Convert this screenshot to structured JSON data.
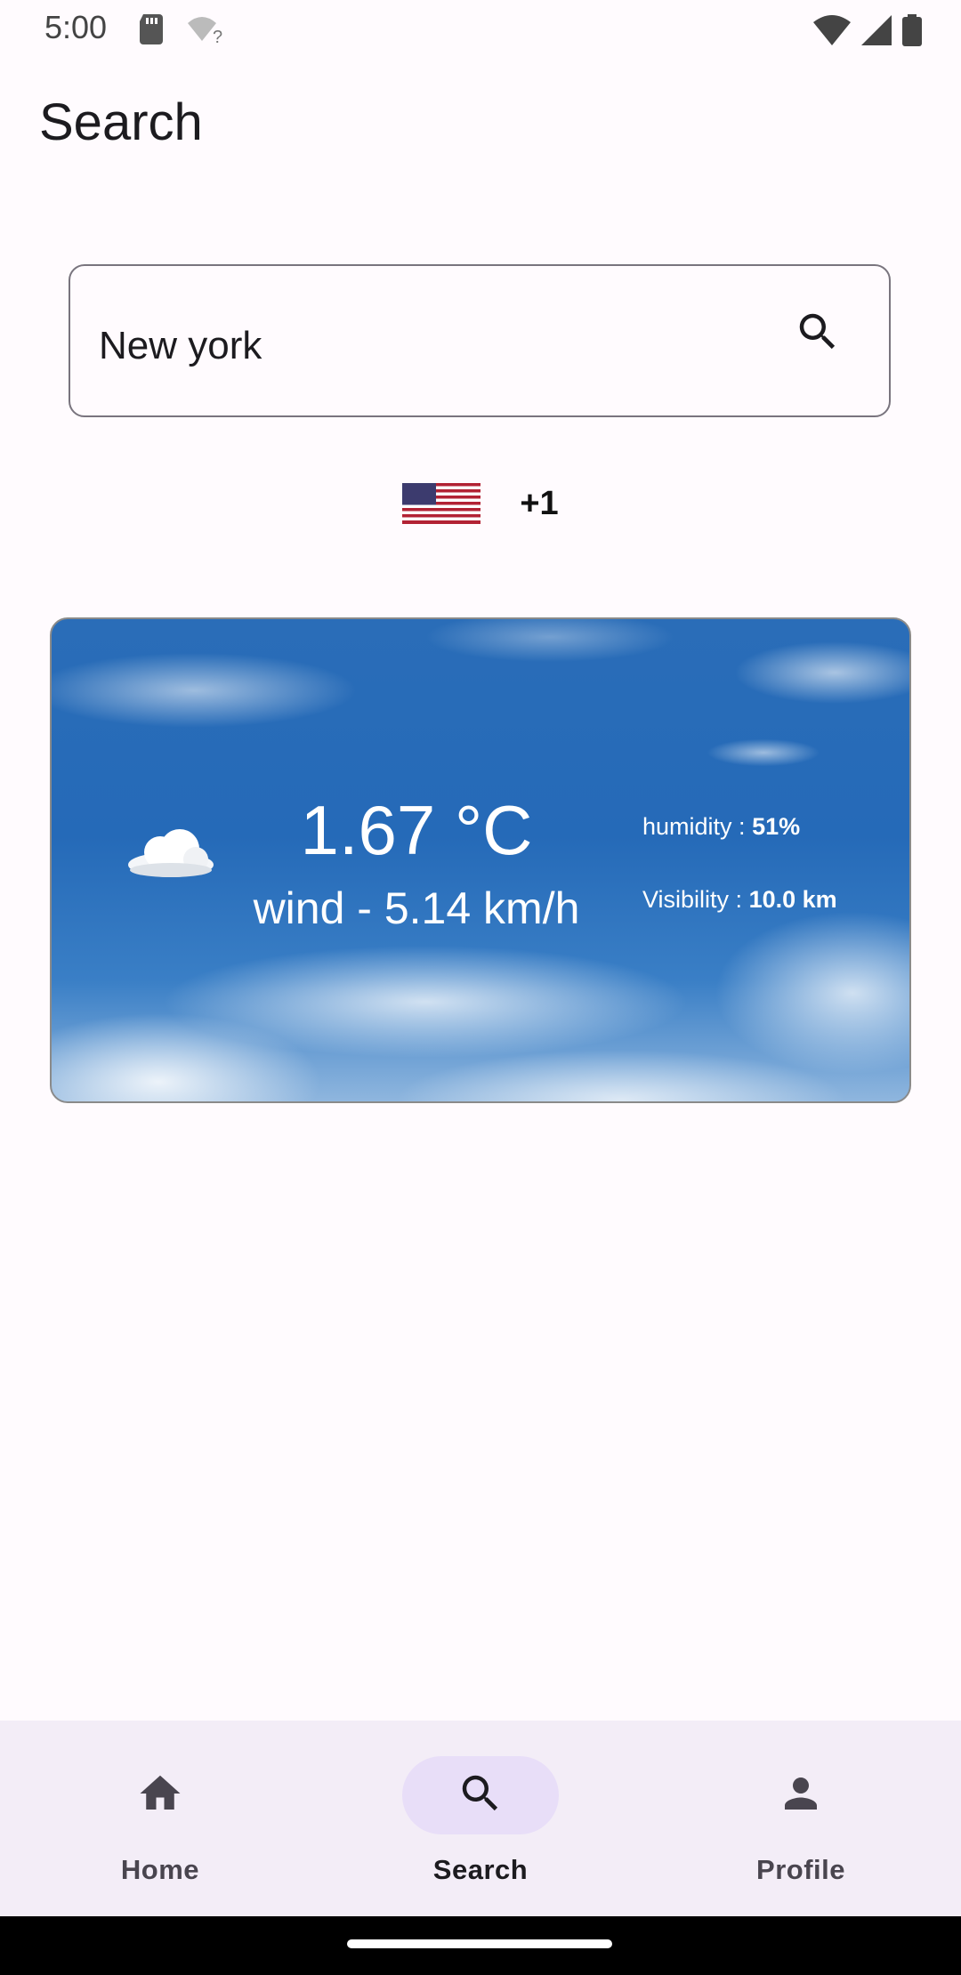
{
  "status_bar": {
    "time": "5:00",
    "icons_left": [
      "sd-card-icon",
      "wifi-question-icon"
    ],
    "icons_right": [
      "wifi-icon",
      "signal-icon",
      "battery-icon"
    ]
  },
  "page": {
    "title": "Search"
  },
  "search": {
    "value": "New york",
    "button_icon": "search-icon"
  },
  "country": {
    "flag_icon": "us-flag-icon",
    "dial_code": "+1"
  },
  "weather": {
    "condition_icon": "cloud-icon",
    "temperature": "1.67 °C",
    "wind": "wind - 5.14 km/h",
    "humidity_label": "humidity :",
    "humidity_value": "51%",
    "visibility_label": "Visibility :",
    "visibility_value": "10.0 km"
  },
  "bottom_nav": {
    "items": [
      {
        "label": "Home",
        "icon": "home-icon",
        "active": false
      },
      {
        "label": "Search",
        "icon": "search-icon",
        "active": true
      },
      {
        "label": "Profile",
        "icon": "person-icon",
        "active": false
      }
    ]
  },
  "colors": {
    "background": "#fffbfe",
    "nav_background": "#f3edf7",
    "active_pill": "#e8def8",
    "outline": "#79747e",
    "sky": "#256ab8"
  }
}
